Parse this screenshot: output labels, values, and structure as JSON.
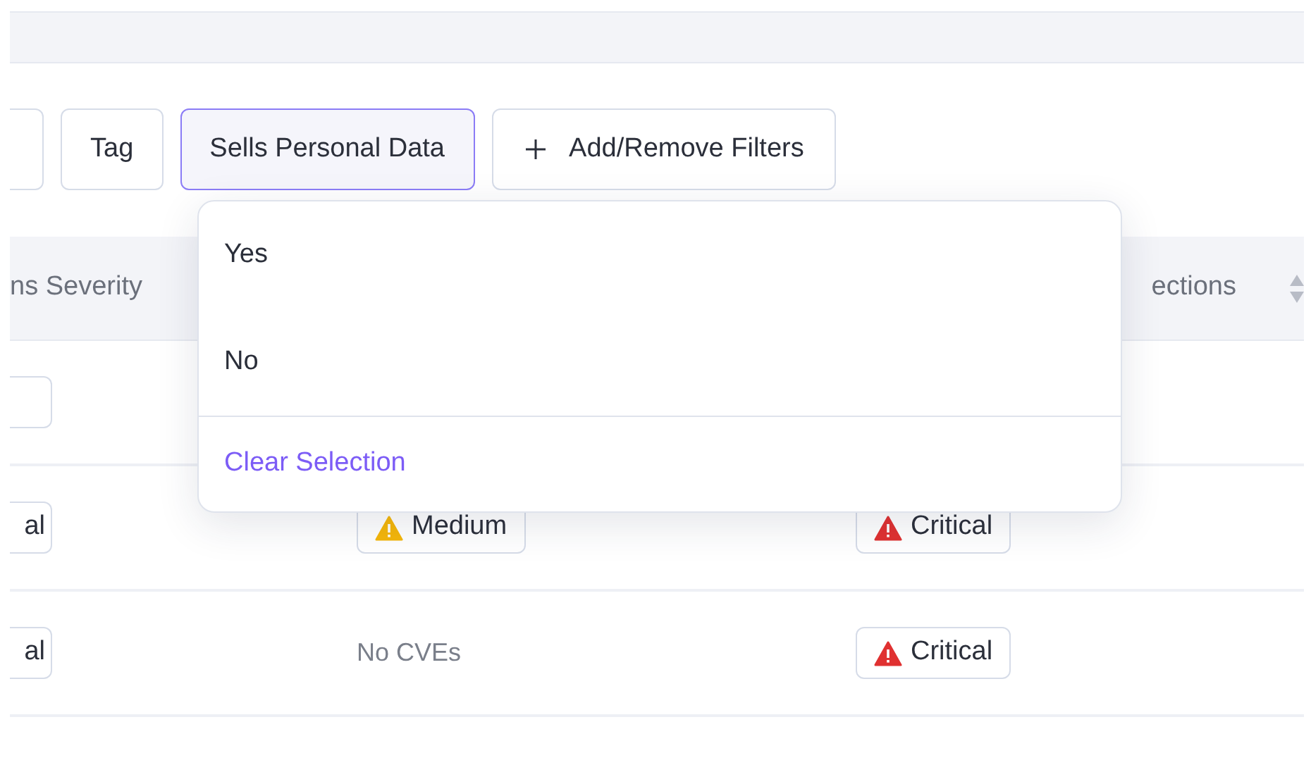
{
  "filters": [
    {
      "selected": false
    },
    {
      "label": "Tag",
      "selected": false
    },
    {
      "label": "Sells Personal Data",
      "selected": true
    }
  ],
  "add_filters_button": {
    "label": "Add/Remove Filters"
  },
  "table": {
    "columns": [
      "ns Severity",
      "ections"
    ],
    "rows": [
      {
        "cells": [
          {
            "kind": "cut_badge"
          }
        ]
      },
      {
        "cells": [
          {
            "kind": "cut_badge",
            "text": "al"
          },
          {
            "kind": "badge",
            "color": "#f5b70a",
            "text": "Medium"
          },
          {
            "kind": "badge",
            "color": "#e03131",
            "text": "Critical"
          }
        ]
      },
      {
        "cells": [
          {
            "kind": "cut_badge",
            "text": "al"
          },
          {
            "kind": "text",
            "text": "No CVEs"
          },
          {
            "kind": "badge",
            "color": "#e03131",
            "text": "Critical"
          }
        ]
      }
    ]
  },
  "dropdown": {
    "options": [
      "Yes",
      "No"
    ],
    "clear_label": "Clear Selection"
  }
}
